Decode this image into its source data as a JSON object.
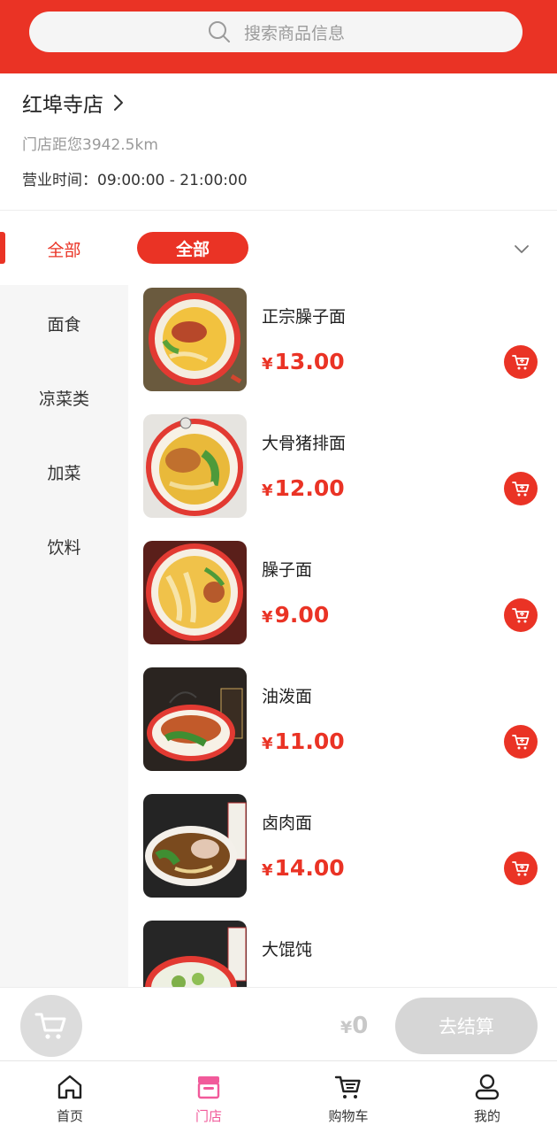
{
  "search": {
    "placeholder": "搜索商品信息"
  },
  "store": {
    "name": "红埠寺店",
    "distance": "门店距您3942.5km",
    "hours": "营业时间：09:00:00 - 21:00:00"
  },
  "category_bar": {
    "left_selected": "全部",
    "pill_label": "全部"
  },
  "sidebar": {
    "items": [
      "面食",
      "凉菜类",
      "加菜",
      "饮料"
    ]
  },
  "products": [
    {
      "name": "正宗臊子面",
      "currency": "¥",
      "price": "13.00"
    },
    {
      "name": "大骨猪排面",
      "currency": "¥",
      "price": "12.00"
    },
    {
      "name": "臊子面",
      "currency": "¥",
      "price": "9.00"
    },
    {
      "name": "油泼面",
      "currency": "¥",
      "price": "11.00"
    },
    {
      "name": "卤肉面",
      "currency": "¥",
      "price": "14.00"
    },
    {
      "name": "大馄饨",
      "currency": "¥",
      "price": ""
    }
  ],
  "checkout": {
    "currency": "¥",
    "total": "0",
    "button_label": "去结算"
  },
  "tabbar": {
    "items": [
      {
        "label": "首页",
        "icon": "home-icon"
      },
      {
        "label": "门店",
        "icon": "store-icon"
      },
      {
        "label": "购物车",
        "icon": "cart-icon"
      },
      {
        "label": "我的",
        "icon": "user-icon"
      }
    ],
    "active": "门店"
  },
  "colors": {
    "brand_red": "#ea3325",
    "active_tab": "#f15a9a",
    "sidebar_bg": "#f6f6f6",
    "disabled_gray": "#d6d6d6"
  }
}
